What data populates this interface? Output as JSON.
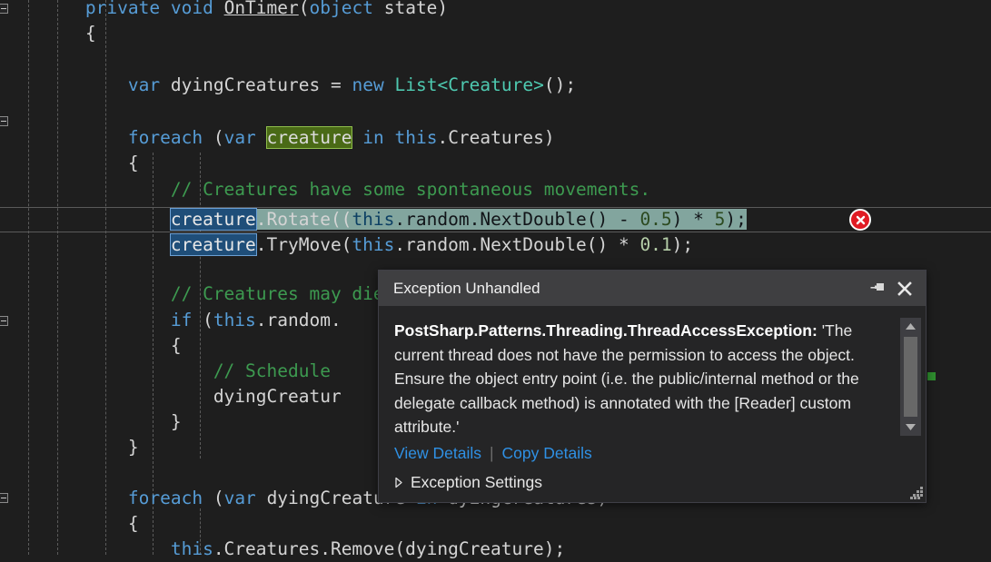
{
  "editor": {
    "background_color": "#1e1e1e",
    "font_size_px": 19.5,
    "lines": [
      {
        "indent": "        ",
        "text": "private void OnTimer(object state)"
      },
      {
        "indent": "        ",
        "text": "{"
      },
      {
        "indent": "",
        "text": ""
      },
      {
        "indent": "            ",
        "text": "var dyingCreatures = new List<Creature>();"
      },
      {
        "indent": "",
        "text": ""
      },
      {
        "indent": "            ",
        "text": "foreach (var creature in this.Creatures)"
      },
      {
        "indent": "            ",
        "text": "{"
      },
      {
        "indent": "                ",
        "text": "// Creatures have some spontaneous movements."
      },
      {
        "indent": "                ",
        "text": "creature.Rotate((this.random.NextDouble() - 0.5) * 5);"
      },
      {
        "indent": "                ",
        "text": "creature.TryMove(this.random.NextDouble() * 0.1);"
      },
      {
        "indent": "",
        "text": ""
      },
      {
        "indent": "                ",
        "text": "// Creatures may die."
      },
      {
        "indent": "                ",
        "text": "if (this.random."
      },
      {
        "indent": "                ",
        "text": "{"
      },
      {
        "indent": "                    ",
        "text": "// Schedule"
      },
      {
        "indent": "                    ",
        "text": "dyingCreatur"
      },
      {
        "indent": "                ",
        "text": "}"
      },
      {
        "indent": "            ",
        "text": "}"
      },
      {
        "indent": "",
        "text": ""
      },
      {
        "indent": "            ",
        "text": "foreach (var dyingCreature in dyingCreatures)"
      },
      {
        "indent": "            ",
        "text": "{"
      },
      {
        "indent": "                ",
        "text": "this.Creatures.Remove(dyingCreature);"
      }
    ],
    "tokens": {
      "line0": {
        "kw1": "private",
        "kw2": "void",
        "method": "OnTimer",
        "kw3": "object",
        "param": "state"
      },
      "line3": {
        "kw": "var",
        "name": "dyingCreatures",
        "eq": "=",
        "new": "new",
        "type": "List",
        "generic": "Creature"
      },
      "line5": {
        "kw": "foreach",
        "var": "var",
        "ident": "creature",
        "in": "in",
        "this": "this",
        "prop": "Creatures"
      },
      "line7": {
        "comment": "// Creatures have some spontaneous movements."
      },
      "line8": {
        "ident": "creature",
        "call": ".Rotate((",
        "this": "this",
        "mid": ".random.NextDouble() - ",
        "num1": "0.5",
        "mid2": ") * ",
        "num2": "5",
        "end": ");"
      },
      "line9": {
        "ident": "creature",
        "call": ".TryMove(",
        "this": "this",
        "mid": ".random.NextDouble() * ",
        "num": "0.1",
        "end": ");"
      },
      "line11": {
        "comment": "// Creatures may die."
      },
      "line12": {
        "kw": "if",
        "open": "(",
        "this": "this",
        "rest": ".random."
      },
      "line14": {
        "comment": "// Schedule"
      },
      "line15": {
        "text": "dyingCreatur"
      },
      "line19": {
        "kw": "foreach",
        "var": "var",
        "ident": "dyingCreature",
        "in": "in",
        "list": "dyingCreatures"
      },
      "line21": {
        "this": "this",
        "rest": ".Creatures.Remove(dyingCreature);"
      }
    },
    "highlights": {
      "reference_highlight_token": "creature",
      "reference_highlight_color": "#4a6a16",
      "selection_color": "#1f4e79",
      "current_statement_color": "#82a59e"
    },
    "glyphs": {
      "error_icon": "error-circle-x-icon",
      "error_icon_color": "#e01b24",
      "change_marker_color": "#2f8f2f"
    }
  },
  "popup": {
    "title": "Exception Unhandled",
    "pin_icon": "pin-icon",
    "close_icon": "close-icon",
    "exception_type": "PostSharp.Patterns.Threading.ThreadAccessException:",
    "exception_message": " 'The current thread does not have the permission to access the object. Ensure the object entry point (i.e. the public/internal method or the delegate callback method) is annotated with the [Reader] custom attribute.'",
    "links": {
      "view_details": "View Details",
      "separator": "|",
      "copy_details": "Copy Details"
    },
    "settings_label": "Exception Settings",
    "expander_icon": "triangle-right-icon",
    "scrollbar": {
      "up_icon": "triangle-up-icon",
      "down_icon": "triangle-down-icon"
    },
    "resize_grip_icon": "resize-grip-icon",
    "link_color": "#2f91e5",
    "titlebar_color": "#3f3f41",
    "body_color": "#252526"
  }
}
